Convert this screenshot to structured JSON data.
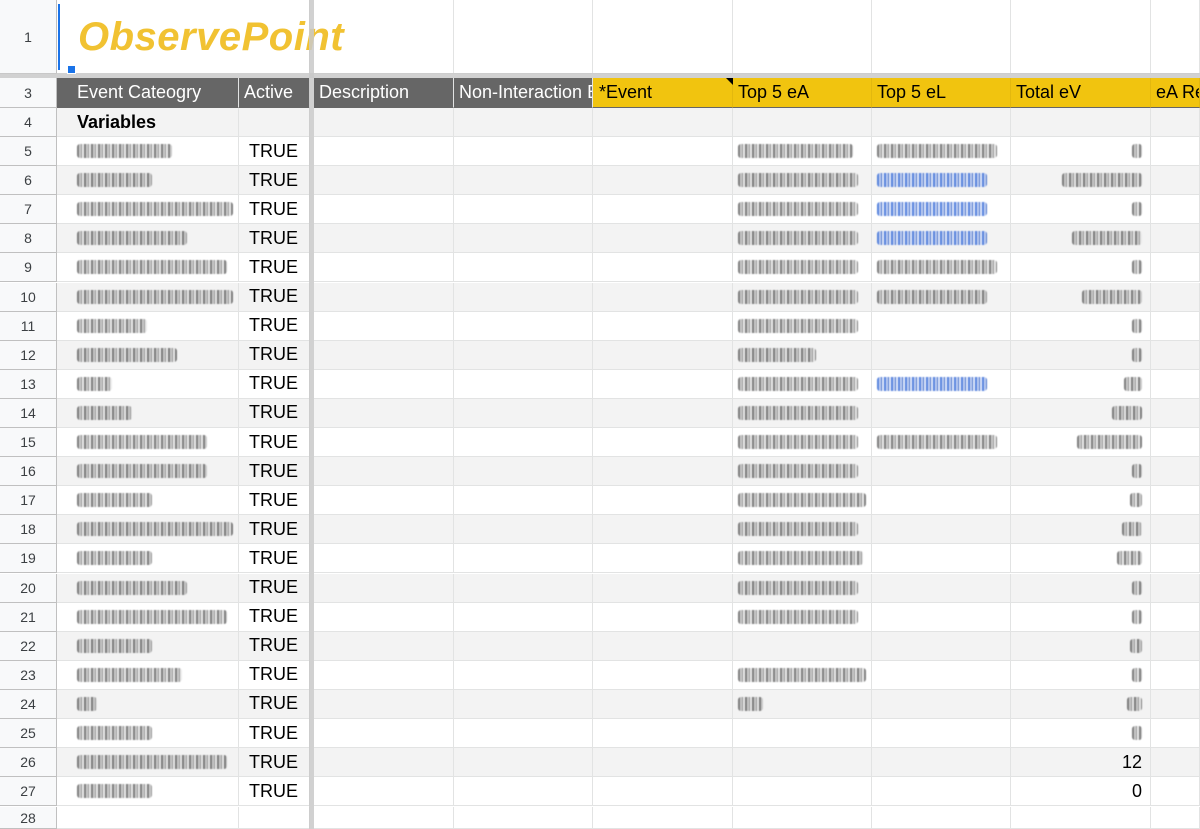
{
  "rows": {
    "r1": "1",
    "r3": "3",
    "r4": "4",
    "r28": "28"
  },
  "logo": "ObservePoint",
  "headers": {
    "event_category": "Event Cateogry",
    "active": "Active",
    "description": "Description",
    "non_interaction": "Non-Interaction E",
    "event": "*Event",
    "top5_ea": "Top 5 eA",
    "top5_el": "Top 5 eL",
    "total_ev": "Total eV",
    "ea_re": "eA Re"
  },
  "variables_label": "Variables",
  "data_rows": [
    {
      "num": "5",
      "active": "TRUE",
      "total": ""
    },
    {
      "num": "6",
      "active": "TRUE",
      "total": ""
    },
    {
      "num": "7",
      "active": "TRUE",
      "total": ""
    },
    {
      "num": "8",
      "active": "TRUE",
      "total": ""
    },
    {
      "num": "9",
      "active": "TRUE",
      "total": ""
    },
    {
      "num": "10",
      "active": "TRUE",
      "total": ""
    },
    {
      "num": "11",
      "active": "TRUE",
      "total": ""
    },
    {
      "num": "12",
      "active": "TRUE",
      "total": ""
    },
    {
      "num": "13",
      "active": "TRUE",
      "total": ""
    },
    {
      "num": "14",
      "active": "TRUE",
      "total": ""
    },
    {
      "num": "15",
      "active": "TRUE",
      "total": ""
    },
    {
      "num": "16",
      "active": "TRUE",
      "total": ""
    },
    {
      "num": "17",
      "active": "TRUE",
      "total": ""
    },
    {
      "num": "18",
      "active": "TRUE",
      "total": ""
    },
    {
      "num": "19",
      "active": "TRUE",
      "total": ""
    },
    {
      "num": "20",
      "active": "TRUE",
      "total": ""
    },
    {
      "num": "21",
      "active": "TRUE",
      "total": ""
    },
    {
      "num": "22",
      "active": "TRUE",
      "total": ""
    },
    {
      "num": "23",
      "active": "TRUE",
      "total": ""
    },
    {
      "num": "24",
      "active": "TRUE",
      "total": ""
    },
    {
      "num": "25",
      "active": "TRUE",
      "total": ""
    },
    {
      "num": "26",
      "active": "TRUE",
      "total": "12"
    },
    {
      "num": "27",
      "active": "TRUE",
      "total": "0"
    }
  ],
  "colors": {
    "header_gray": "#666666",
    "header_yellow": "#f1c40f",
    "logo_yellow": "#f1c232",
    "selection_blue": "#1a73e8"
  }
}
